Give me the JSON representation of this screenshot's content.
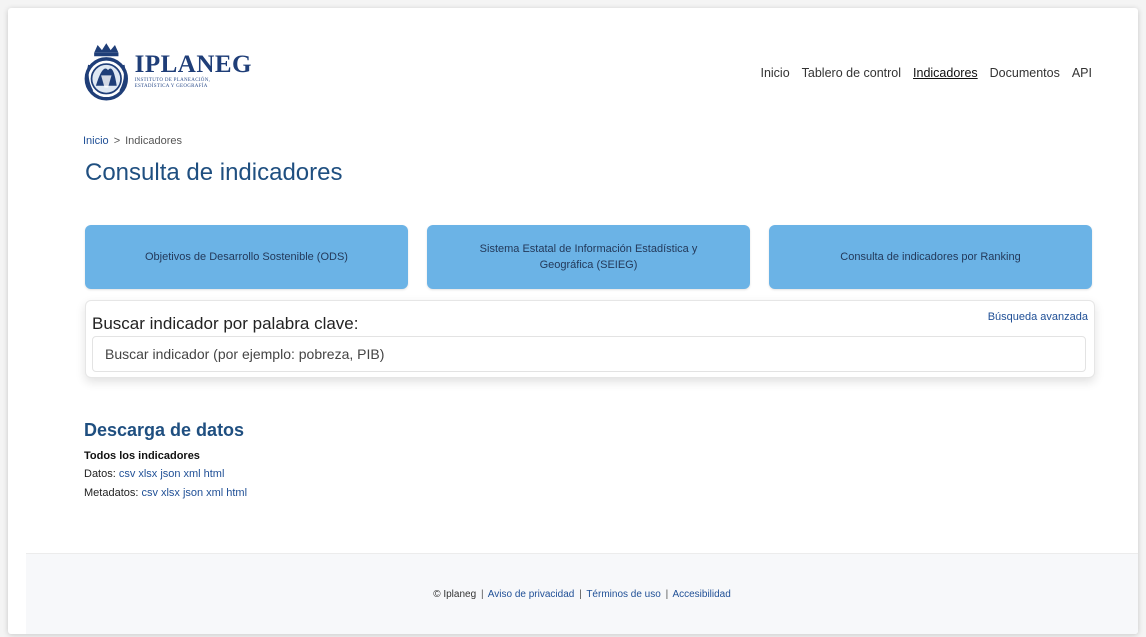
{
  "header": {
    "brand_name": "IPLANEG",
    "brand_sub_1": "INSTITUTO DE PLANEACIÓN,",
    "brand_sub_2": "ESTADÍSTICA Y GEOGRAFÍA",
    "nav": [
      {
        "label": "Inicio"
      },
      {
        "label": "Tablero de control"
      },
      {
        "label": "Indicadores",
        "active": true
      },
      {
        "label": "Documentos"
      },
      {
        "label": "API"
      }
    ]
  },
  "breadcrumb": {
    "home": "Inicio",
    "separator": ">",
    "current": "Indicadores"
  },
  "page_title": "Consulta de indicadores",
  "cards": [
    {
      "label": "Objetivos de Desarrollo Sostenible (ODS)"
    },
    {
      "label": "Sistema Estatal de Información Estadística y Geográfica (SEIEG)"
    },
    {
      "label": "Consulta de indicadores por Ranking"
    }
  ],
  "search": {
    "label": "Buscar indicador por palabra clave:",
    "advanced": "Búsqueda avanzada",
    "placeholder": "Buscar indicador (por ejemplo: pobreza, PIB)",
    "value": ""
  },
  "download": {
    "title": "Descarga de datos",
    "subtitle": "Todos los indicadores",
    "data_label": "Datos:",
    "meta_label": "Metadatos:",
    "formats": [
      "csv",
      "xlsx",
      "json",
      "xml",
      "html"
    ]
  },
  "footer": {
    "copyright": "© Iplaneg",
    "separator": "|",
    "links": [
      "Aviso de privacidad",
      "Términos de uso",
      "Accesibilidad"
    ]
  },
  "colors": {
    "accent": "#1f4f80",
    "card": "#6bb3e6",
    "link": "#1f4f96"
  }
}
